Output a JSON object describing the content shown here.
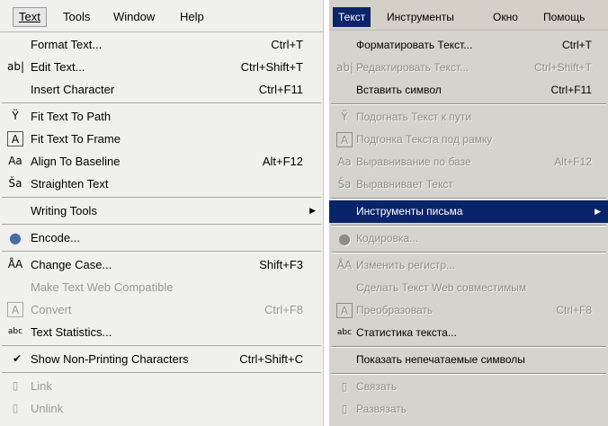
{
  "left_menu": {
    "menubar": [
      {
        "label": "Text",
        "active": true
      },
      {
        "label": "Tools",
        "active": false
      },
      {
        "label": "Window",
        "active": false
      },
      {
        "label": "Help",
        "active": false
      }
    ],
    "items": [
      {
        "label": "Format Text...",
        "shortcut": "Ctrl+T",
        "icon": "",
        "disabled": false
      },
      {
        "label": "Edit Text...",
        "shortcut": "Ctrl+Shift+T",
        "icon": "edit-text-icon",
        "disabled": false
      },
      {
        "label": "Insert Character",
        "shortcut": "Ctrl+F11",
        "icon": "",
        "disabled": false
      },
      {
        "label": "Fit Text To Path",
        "shortcut": "",
        "icon": "fit-path-icon",
        "disabled": false
      },
      {
        "label": "Fit Text To Frame",
        "shortcut": "",
        "icon": "fit-frame-icon",
        "disabled": false
      },
      {
        "label": "Align To Baseline",
        "shortcut": "Alt+F12",
        "icon": "baseline-icon",
        "disabled": false
      },
      {
        "label": "Straighten Text",
        "shortcut": "",
        "icon": "straighten-icon",
        "disabled": false
      },
      {
        "label": "Writing Tools",
        "shortcut": "",
        "icon": "",
        "disabled": false
      },
      {
        "label": "Encode...",
        "shortcut": "",
        "icon": "globe-icon",
        "disabled": false
      },
      {
        "label": "Change Case...",
        "shortcut": "Shift+F3",
        "icon": "change-case-icon",
        "disabled": false
      },
      {
        "label": "Make Text Web Compatible",
        "shortcut": "",
        "icon": "",
        "disabled": true
      },
      {
        "label": "Convert",
        "shortcut": "Ctrl+F8",
        "icon": "convert-icon",
        "disabled": true
      },
      {
        "label": "Text Statistics...",
        "shortcut": "",
        "icon": "statistics-icon",
        "disabled": false
      },
      {
        "label": "Show Non-Printing Characters",
        "shortcut": "Ctrl+Shift+C",
        "icon": "checkmark-icon",
        "disabled": false
      },
      {
        "label": "Link",
        "shortcut": "",
        "icon": "link-icon",
        "disabled": true
      },
      {
        "label": "Unlink",
        "shortcut": "",
        "icon": "unlink-icon",
        "disabled": true
      }
    ]
  },
  "right_menu": {
    "menubar": [
      {
        "label": "Текст",
        "active": true
      },
      {
        "label": "Инструменты",
        "active": false
      },
      {
        "label": "Окно",
        "active": false
      },
      {
        "label": "Помощь",
        "active": false
      }
    ],
    "items": [
      {
        "label": "Форматировать Текст...",
        "shortcut": "Ctrl+T",
        "disabled": false
      },
      {
        "label": "Редактировать Текст...",
        "shortcut": "Ctrl+Shift+T",
        "disabled": true
      },
      {
        "label": "Вставить символ",
        "shortcut": "Ctrl+F11",
        "disabled": false
      },
      {
        "label": "Подогнать Текст к пути",
        "shortcut": "",
        "disabled": true
      },
      {
        "label": "Подгонка Текста под рамку",
        "shortcut": "",
        "disabled": true
      },
      {
        "label": "Выравнивание по базе",
        "shortcut": "Alt+F12",
        "disabled": true
      },
      {
        "label": "Выравнивает Текст",
        "shortcut": "",
        "disabled": true
      },
      {
        "label": "Инструменты письма",
        "shortcut": "",
        "disabled": false
      },
      {
        "label": "Кодировка...",
        "shortcut": "",
        "disabled": true
      },
      {
        "label": "Изменить регистр...",
        "shortcut": "",
        "disabled": true
      },
      {
        "label": "Сделать Текст Web совместимым",
        "shortcut": "",
        "disabled": true
      },
      {
        "label": "Преобразовать",
        "shortcut": "Ctrl+F8",
        "disabled": true
      },
      {
        "label": "Статистика текста...",
        "shortcut": "",
        "disabled": false
      },
      {
        "label": "Показать непечатаемые символы",
        "shortcut": "",
        "disabled": false
      },
      {
        "label": "Связать",
        "shortcut": "",
        "disabled": true
      },
      {
        "label": "Развязать",
        "shortcut": "",
        "disabled": true
      }
    ]
  },
  "icons": {
    "edit_text": "ab|",
    "fit_path": "Ÿ",
    "fit_frame": "A",
    "baseline": "Aa",
    "straighten": "Ša",
    "globe": "●",
    "change_case": "ÅA",
    "convert": "A",
    "statistics": "abc",
    "check": "✔",
    "link": "▯",
    "unlink": "▯",
    "submenu_arrow": "▶"
  },
  "colors": {
    "highlight": "#0a246a",
    "disabled": "#9a9a9a"
  }
}
